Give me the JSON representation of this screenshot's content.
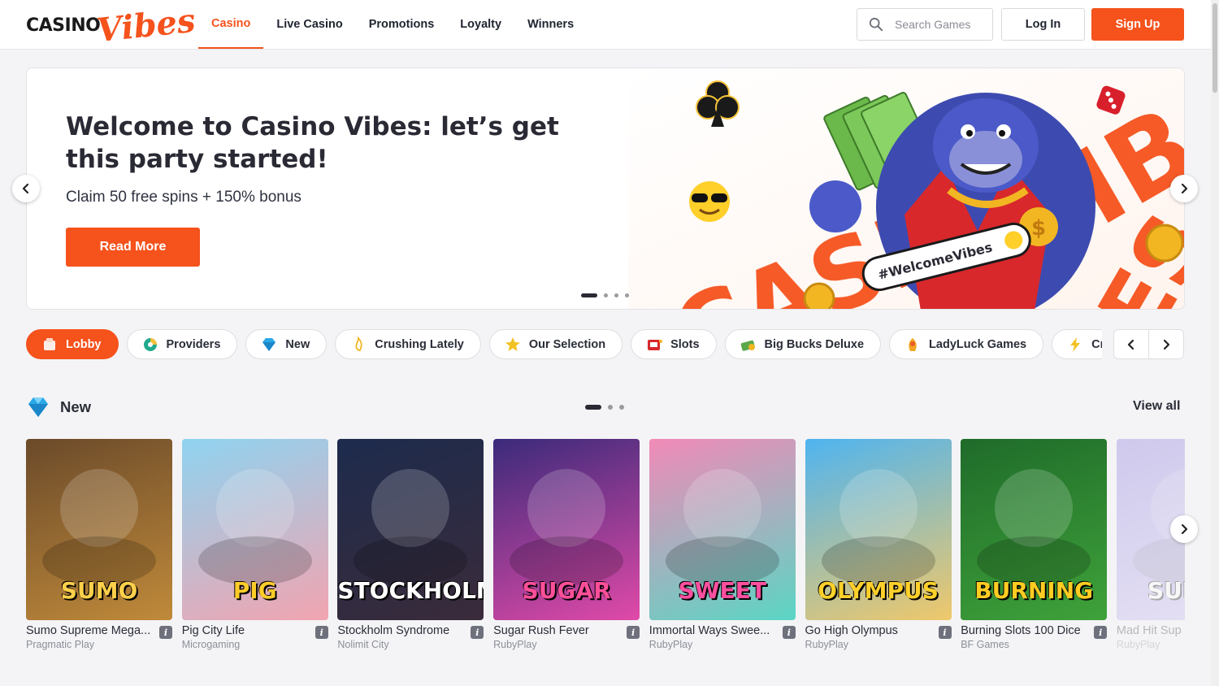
{
  "brand": {
    "casino": "CASINO",
    "vibes": "Vibes"
  },
  "nav": [
    {
      "label": "Casino",
      "active": true
    },
    {
      "label": "Live Casino"
    },
    {
      "label": "Promotions"
    },
    {
      "label": "Loyalty"
    },
    {
      "label": "Winners"
    }
  ],
  "search": {
    "placeholder": "Search Games"
  },
  "auth": {
    "login": "Log In",
    "signup": "Sign Up"
  },
  "hero": {
    "title": "Welcome to Casino Vibes: let’s get this party started!",
    "subtitle": "Claim 50 free spins + 150% bonus",
    "cta": "Read More",
    "hashtag": "#WelcomeVibes",
    "slides": 4,
    "active_slide": 1
  },
  "categories": [
    {
      "label": "Lobby",
      "icon": "lobby-icon",
      "active": true
    },
    {
      "label": "Providers",
      "icon": "providers-icon"
    },
    {
      "label": "New",
      "icon": "diamond-icon"
    },
    {
      "label": "Crushing Lately",
      "icon": "flame-icon"
    },
    {
      "label": "Our Selection",
      "icon": "star-icon"
    },
    {
      "label": "Slots",
      "icon": "slot-icon"
    },
    {
      "label": "Big Bucks Deluxe",
      "icon": "cash-icon"
    },
    {
      "label": "LadyLuck Games",
      "icon": "lady-icon"
    },
    {
      "label": "Cr",
      "icon": "bolt-icon"
    }
  ],
  "new_section": {
    "title": "New",
    "view_all": "View all",
    "pages": 3,
    "active_page": 1,
    "games": [
      {
        "name": "Sumo Supreme Mega...",
        "provider": "Pragmatic Play",
        "art": "SUMO",
        "colors": [
          "#6b4a2a",
          "#c08a3a"
        ],
        "text_color": "#ffd04a"
      },
      {
        "name": "Pig City Life",
        "provider": "Microgaming",
        "art": "PIG",
        "colors": [
          "#8fd3f0",
          "#f2a4b0"
        ],
        "text_color": "#ffcc2a"
      },
      {
        "name": "Stockholm Syndrome",
        "provider": "Nolimit City",
        "art": "STOCKHOLM",
        "colors": [
          "#1d2b4d",
          "#3a2b3a"
        ],
        "text_color": "#ffffff"
      },
      {
        "name": "Sugar Rush Fever",
        "provider": "RubyPlay",
        "art": "SUGAR",
        "colors": [
          "#3b2a7a",
          "#e04aa8"
        ],
        "text_color": "#ff4f9a"
      },
      {
        "name": "Immortal Ways Swee...",
        "provider": "RubyPlay",
        "art": "SWEET",
        "colors": [
          "#f28ab8",
          "#5ad6c4"
        ],
        "text_color": "#ff4fa0"
      },
      {
        "name": "Go High Olympus",
        "provider": "RubyPlay",
        "art": "OLYMPUS",
        "colors": [
          "#4fb4f0",
          "#f0c86a"
        ],
        "text_color": "#ffd02a"
      },
      {
        "name": "Burning Slots 100 Dice",
        "provider": "BF Games",
        "art": "BURNING",
        "colors": [
          "#1f6b2a",
          "#3fa23a"
        ],
        "text_color": "#ffcc22"
      },
      {
        "name": "Mad Hit Sup",
        "provider": "RubyPlay",
        "art": "SUPER",
        "colors": [
          "#7a6ad8",
          "#c8b8f0"
        ],
        "text_color": "#ffffff"
      }
    ]
  },
  "colors": {
    "accent": "#f5521c",
    "text": "#2a2d38"
  }
}
